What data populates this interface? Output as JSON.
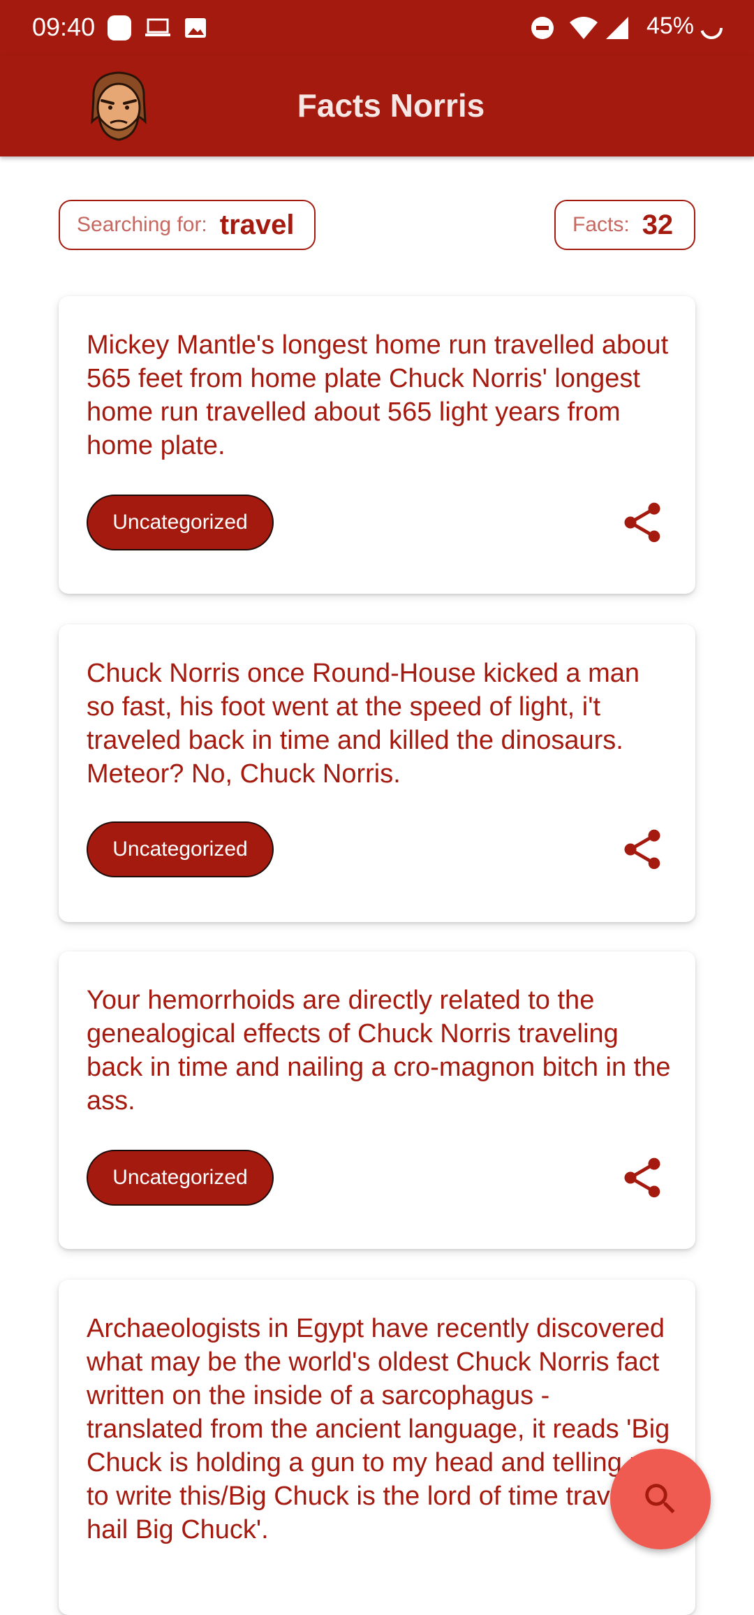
{
  "status_bar": {
    "time": "09:40",
    "battery": "45%"
  },
  "app": {
    "title": "Facts Norris"
  },
  "search": {
    "label": "Searching for:",
    "term": "travel"
  },
  "count": {
    "label": "Facts:",
    "value": "32"
  },
  "facts": [
    {
      "text": "Mickey Mantle's longest home run travelled about 565 feet from home plate Chuck Norris' longest home run travelled about 565 light years from home plate.",
      "category": "Uncategorized"
    },
    {
      "text": "Chuck Norris once Round-House kicked a man so fast, his foot went at the speed of light, i't traveled back in time and killed the dinosaurs. Meteor? No, Chuck Norris.",
      "category": "Uncategorized"
    },
    {
      "text": "Your hemorrhoids are directly related to the genealogical effects of Chuck Norris traveling back in time and nailing a cro-magnon bitch in the ass.",
      "category": "Uncategorized"
    },
    {
      "text": "Archaeologists in Egypt have recently discovered what may be the world's oldest Chuck Norris fact written on the inside of a sarcophagus - translated from the ancient language, it reads 'Big Chuck is holding a gun to my head and telling me to write this/Big Chuck is the lord of time travel/All hail Big Chuck'."
    }
  ],
  "icons": {
    "share": "share-icon",
    "search": "search-icon",
    "logo": "chuck-norris-avatar"
  },
  "colors": {
    "primary": "#a51a0f",
    "fab": "#ef5b50"
  }
}
